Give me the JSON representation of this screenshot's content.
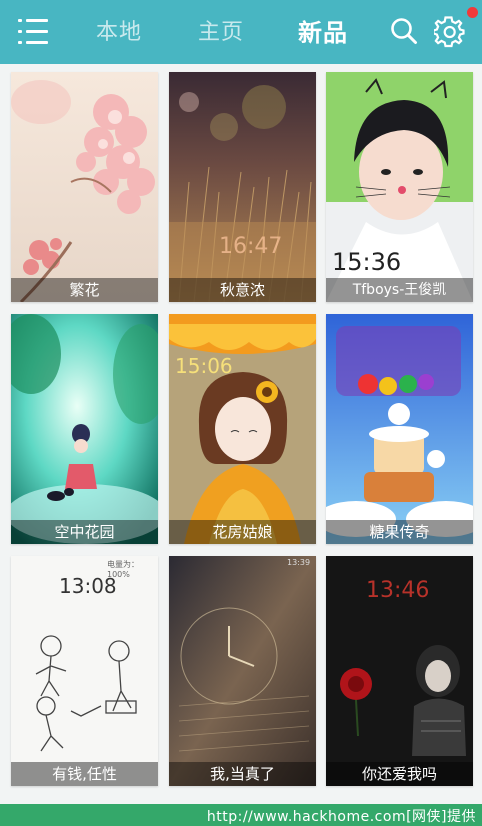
{
  "header": {
    "tabs": [
      {
        "label": "本地",
        "active": false
      },
      {
        "label": "主页",
        "active": false
      },
      {
        "label": "新品",
        "active": true
      }
    ],
    "notification_color": "#f13a3a",
    "accent": "#48b6c2"
  },
  "themes": [
    {
      "title": "繁花",
      "icon": "cherry-blossom-image"
    },
    {
      "title": "秋意浓",
      "icon": "autumn-grass-image",
      "overlay_time": "16:47"
    },
    {
      "title": "Tfboys-王俊凯",
      "icon": "boy-portrait-image",
      "overlay_time": "15:36"
    },
    {
      "title": "空中花园",
      "icon": "sky-garden-image"
    },
    {
      "title": "花房姑娘",
      "icon": "flower-girl-image",
      "overlay_time": "15:06"
    },
    {
      "title": "糖果传奇",
      "icon": "candy-legend-image"
    },
    {
      "title": "有钱,任性",
      "icon": "sketch-figures-image",
      "overlay_time": "13:08",
      "overlay_status": "电量为：100%"
    },
    {
      "title": "我,当真了",
      "icon": "sepia-clock-image",
      "overlay_status": "13:39"
    },
    {
      "title": "你还爱我吗",
      "icon": "dark-rose-image",
      "overlay_time": "13:46"
    }
  ],
  "footer": {
    "text": "http://www.hackhome.com[网侠]提供"
  }
}
